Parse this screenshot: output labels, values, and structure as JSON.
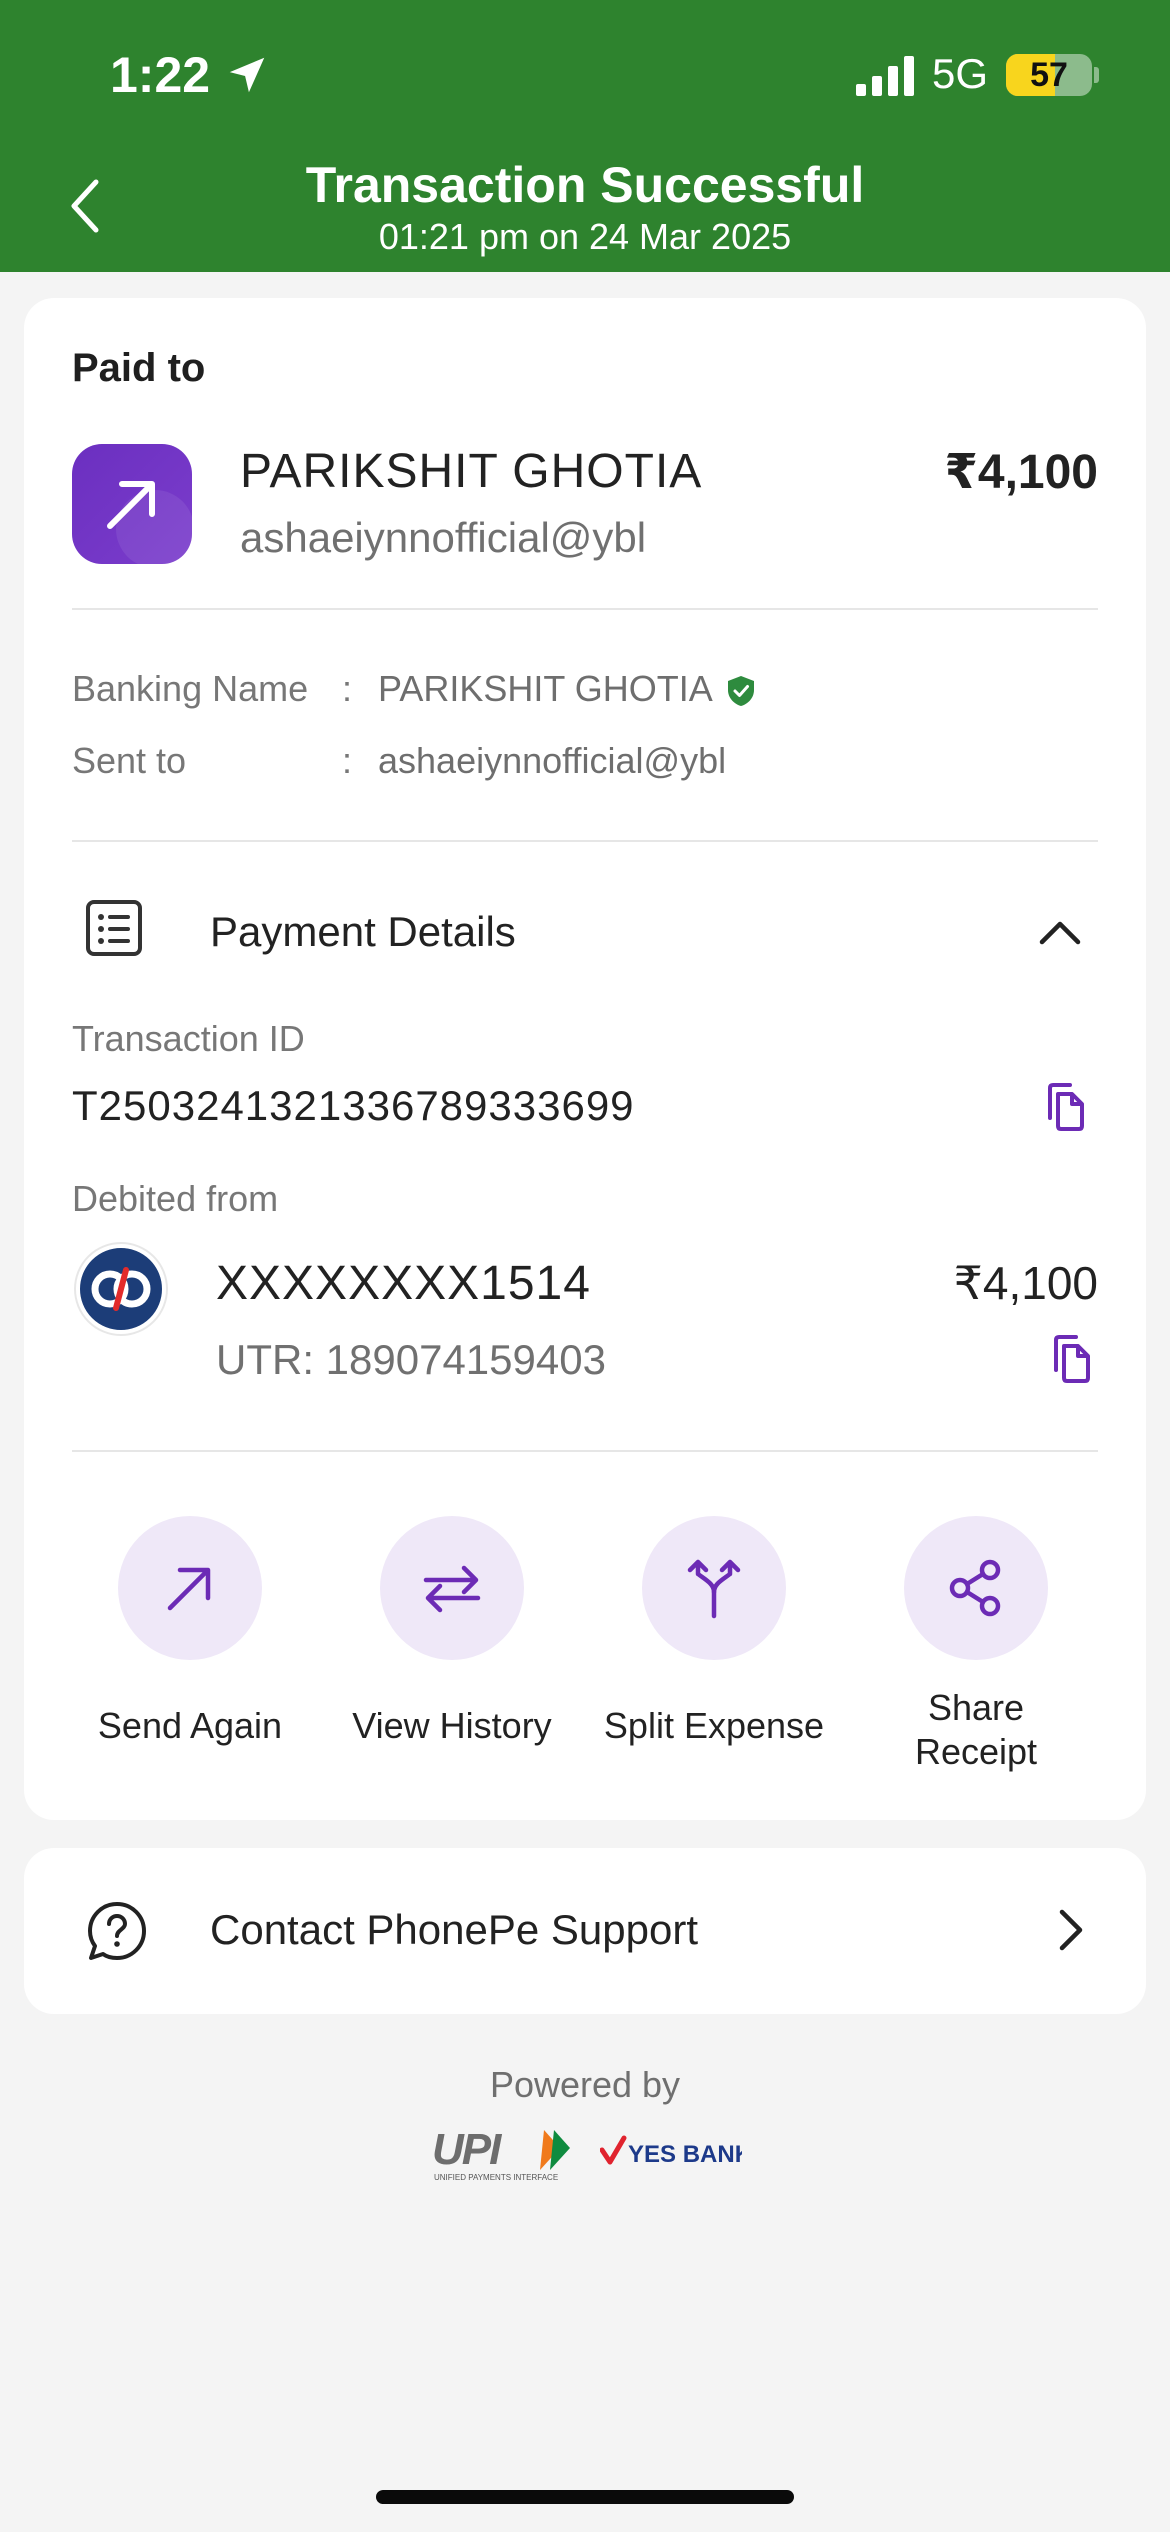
{
  "status_bar": {
    "time": "1:22",
    "network": "5G",
    "battery": "57",
    "battery_level": 0.57
  },
  "header": {
    "title": "Transaction Successful",
    "subtitle": "01:21 pm on 24 Mar 2025"
  },
  "payee": {
    "section_label": "Paid to",
    "name": "PARIKSHIT GHOTIA",
    "vpa": "ashaeiynnofficial@ybl",
    "amount": "₹4,100"
  },
  "details": {
    "banking_name_label": "Banking Name",
    "banking_name": "PARIKSHIT GHOTIA",
    "sent_to_label": "Sent to",
    "sent_to": "ashaeiynnofficial@ybl",
    "colon": ":"
  },
  "payment_details": {
    "title": "Payment Details",
    "transaction_id_label": "Transaction ID",
    "transaction_id": "T2503241321336789333699",
    "debited_from_label": "Debited from",
    "account": "XXXXXXXX1514",
    "utr": "UTR: 189074159403",
    "amount": "₹4,100"
  },
  "actions": [
    {
      "label": "Send Again",
      "icon": "arrow-up-right-icon"
    },
    {
      "label": "View History",
      "icon": "swap-arrows-icon"
    },
    {
      "label": "Split Expense",
      "icon": "split-arrows-icon"
    },
    {
      "label": "Share Receipt",
      "icon": "share-icon"
    }
  ],
  "support": {
    "label": "Contact PhonePe Support"
  },
  "footer": {
    "powered_by": "Powered by"
  },
  "colors": {
    "header_green": "#2e832e",
    "accent_purple": "#6c2bb5",
    "action_bg": "#efe8f8"
  }
}
